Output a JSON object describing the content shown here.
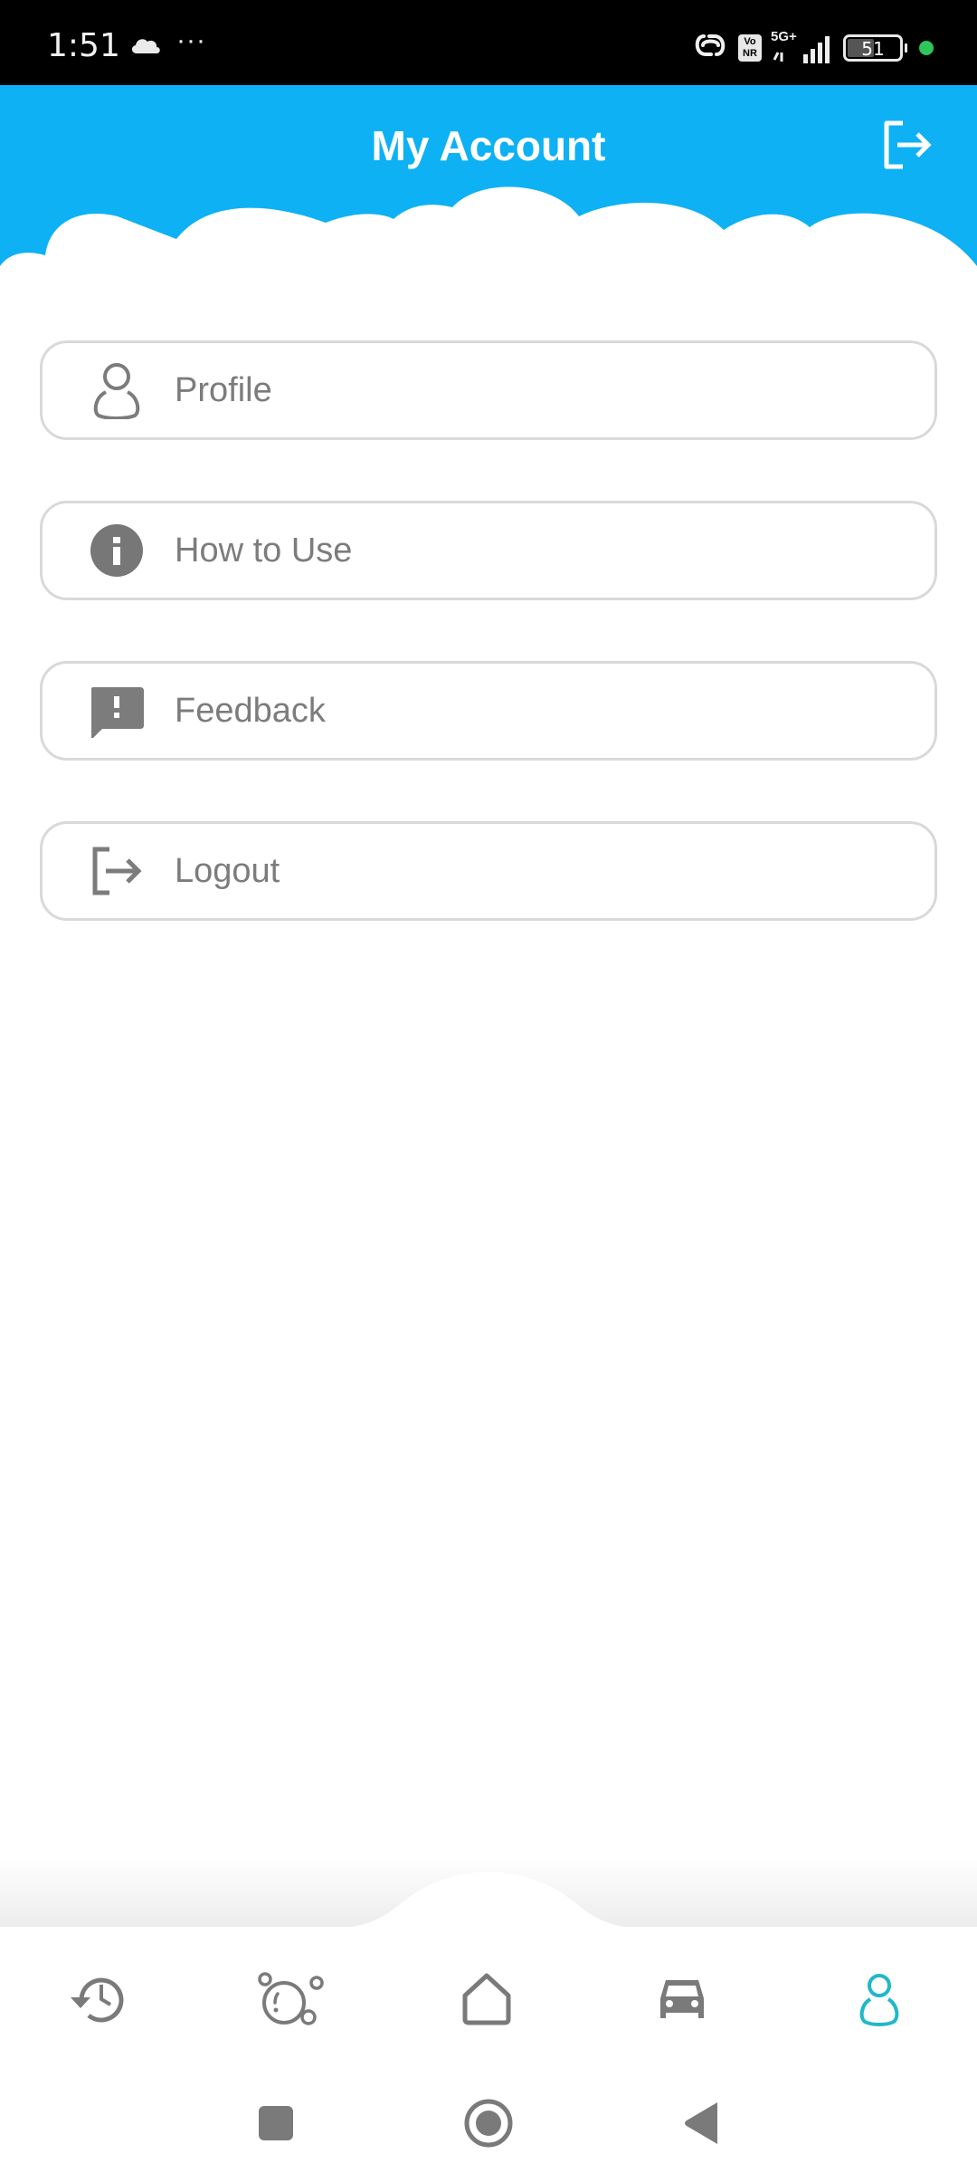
{
  "status_bar": {
    "time": "1:51",
    "network_label": "5G+",
    "vonr_label": "Vo NR",
    "battery_level": "51",
    "icons": [
      "cloud-icon",
      "more-dots-icon",
      "link-icon",
      "vonr-icon",
      "signal-icon",
      "battery-icon",
      "privacy-dot-icon"
    ]
  },
  "header": {
    "title": "My Account",
    "action_icon": "logout-icon",
    "background_color": "#0db1f4"
  },
  "menu": {
    "items": [
      {
        "label": "Profile",
        "icon": "person-outline-icon"
      },
      {
        "label": "How to Use",
        "icon": "info-icon"
      },
      {
        "label": "Feedback",
        "icon": "feedback-icon"
      },
      {
        "label": "Logout",
        "icon": "logout-icon"
      }
    ],
    "text_color": "#7c7c7c",
    "border_color": "#d9d9d9"
  },
  "bottom_nav": {
    "items": [
      {
        "name": "history",
        "icon": "history-icon",
        "active": false
      },
      {
        "name": "bubbles",
        "icon": "bubbles-icon",
        "active": false
      },
      {
        "name": "home",
        "icon": "home-icon",
        "active": false
      },
      {
        "name": "vehicle",
        "icon": "car-icon",
        "active": false
      },
      {
        "name": "account",
        "icon": "person-outline-icon",
        "active": true
      }
    ],
    "active_color": "#1fb8c9",
    "inactive_color": "#7a7a7a"
  },
  "system_nav": {
    "buttons": [
      "recents-button",
      "home-button",
      "back-button"
    ]
  }
}
